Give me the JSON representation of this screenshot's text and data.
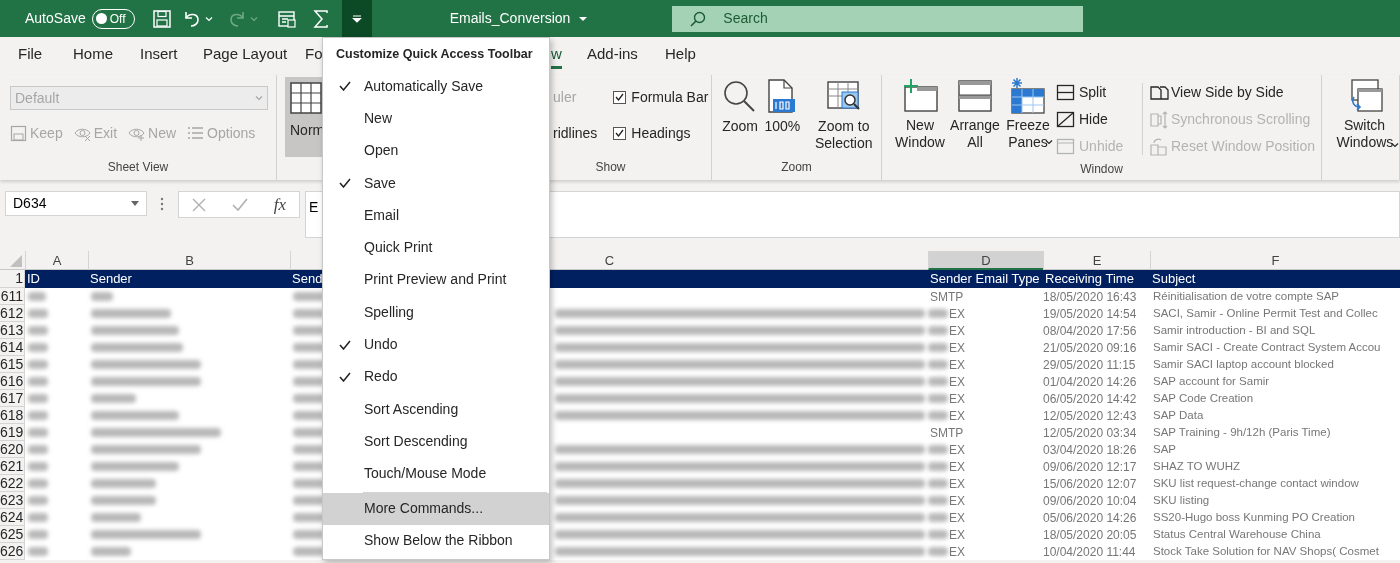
{
  "title_bar": {
    "autosave_label": "AutoSave",
    "autosave": {
      "on": false,
      "label": "Off"
    },
    "redo_disabled": true,
    "workbook_title": "Emails_Conversion",
    "search": {
      "placeholder": "Search"
    }
  },
  "tabs": [
    {
      "label": "File",
      "selected": false
    },
    {
      "label": "Home",
      "selected": false
    },
    {
      "label": "Insert",
      "selected": false
    },
    {
      "label": "Page Layout",
      "selected": false
    },
    {
      "label": "Fo",
      "selected": false
    },
    {
      "label": "w",
      "selected": true
    },
    {
      "label": "Add-ins",
      "selected": false
    },
    {
      "label": "Help",
      "selected": false
    }
  ],
  "ribbon": {
    "sheet_view": {
      "select": {
        "value": "Default",
        "disabled": true
      },
      "buttons": [
        {
          "label": "Keep",
          "disabled": true
        },
        {
          "label": "Exit",
          "disabled": true
        },
        {
          "label": "New",
          "disabled": true
        },
        {
          "label": "Options",
          "disabled": true
        }
      ],
      "label": "Sheet View"
    },
    "workbook_views": {
      "buttons": [
        {
          "label": "Norm",
          "selected": true
        }
      ]
    },
    "show": {
      "partial_items": [
        {
          "label": "uler",
          "disabled": true
        },
        {
          "label": "ridlines",
          "disabled": false
        }
      ],
      "checkboxes": [
        {
          "label": "Formula Bar",
          "checked": true
        },
        {
          "label": "Headings",
          "checked": true
        }
      ],
      "label": "Show"
    },
    "zoom": {
      "buttons": [
        {
          "label": "Zoom"
        },
        {
          "label": "100%"
        },
        {
          "label": "Zoom to Selection"
        }
      ],
      "label": "Zoom"
    },
    "window": {
      "large_buttons": [
        {
          "label": "New Window",
          "dropdown": false
        },
        {
          "label": "Arrange All",
          "dropdown": false
        },
        {
          "label": "Freeze Panes",
          "dropdown": true
        }
      ],
      "small_buttons": [
        {
          "label": "Split",
          "disabled": false
        },
        {
          "label": "Hide",
          "disabled": false
        },
        {
          "label": "Unhide",
          "disabled": true
        }
      ],
      "side_buttons": [
        {
          "label": "View Side by Side",
          "disabled": false
        },
        {
          "label": "Synchronous Scrolling",
          "disabled": true
        },
        {
          "label": "Reset Window Position",
          "disabled": true
        }
      ],
      "label": "Window"
    },
    "switch_windows": {
      "label": "Switch Windows",
      "dropdown": true
    }
  },
  "formula_bar": {
    "name_box": "D634",
    "fx": "fx",
    "value": "E"
  },
  "column_headers": [
    {
      "label": "A",
      "selected": false
    },
    {
      "label": "B",
      "selected": false
    },
    {
      "label": "C",
      "selected": false
    },
    {
      "label": "D",
      "selected": true
    },
    {
      "label": "E",
      "selected": false
    },
    {
      "label": "F",
      "selected": false
    }
  ],
  "header_row": {
    "row": "1",
    "cells": [
      "ID",
      "Sender",
      "Send",
      "Sender Email Type",
      "Receiving Time",
      "Subject"
    ]
  },
  "rows": [
    {
      "row": "611",
      "kind": "smtp",
      "sender_email_type": "SMTP",
      "receiving_time": "18/05/2020 16:43",
      "subject": "Réinitialisation de votre compte SAP"
    },
    {
      "row": "612",
      "kind": "exchange",
      "sender_email_type": "EX",
      "receiving_time": "19/05/2020 14:54",
      "subject": "SACI, Samir - Online Permit Test and Collec"
    },
    {
      "row": "613",
      "kind": "exchange",
      "sender_email_type": "EX",
      "receiving_time": "08/04/2020 17:56",
      "subject": "Samir introduction - BI and SQL"
    },
    {
      "row": "614",
      "kind": "exchange",
      "sender_email_type": "EX",
      "receiving_time": "21/05/2020 09:16",
      "subject": "Samir SACI - Create Contract System Accou"
    },
    {
      "row": "615",
      "kind": "exchange",
      "sender_email_type": "EX",
      "receiving_time": "29/05/2020 11:15",
      "subject": "Samir SACI laptop account blocked"
    },
    {
      "row": "616",
      "kind": "exchange",
      "sender_email_type": "EX",
      "receiving_time": "01/04/2020 14:26",
      "subject": "SAP account for Samir"
    },
    {
      "row": "617",
      "kind": "exchange",
      "sender_email_type": "EX",
      "receiving_time": "06/05/2020 14:42",
      "subject": "SAP Code Creation"
    },
    {
      "row": "618",
      "kind": "exchange",
      "sender_email_type": "EX",
      "receiving_time": "12/05/2020 12:43",
      "subject": "SAP Data"
    },
    {
      "row": "619",
      "kind": "smtp",
      "sender_email_type": "SMTP",
      "receiving_time": "12/05/2020 03:34",
      "subject": "SAP Training - 9h/12h (Paris Time)"
    },
    {
      "row": "620",
      "kind": "exchange",
      "sender_email_type": "EX",
      "receiving_time": "03/04/2020 18:26",
      "subject": "SAP"
    },
    {
      "row": "621",
      "kind": "exchange",
      "sender_email_type": "EX",
      "receiving_time": "09/06/2020 12:17",
      "subject": "SHAZ TO WUHZ"
    },
    {
      "row": "622",
      "kind": "exchange",
      "sender_email_type": "EX",
      "receiving_time": "15/06/2020 12:07",
      "subject": "SKU list request-change contact window"
    },
    {
      "row": "623",
      "kind": "exchange",
      "sender_email_type": "EX",
      "receiving_time": "09/06/2020 10:04",
      "subject": "SKU listing"
    },
    {
      "row": "624",
      "kind": "exchange",
      "sender_email_type": "EX",
      "receiving_time": "05/06/2020 14:26",
      "subject": "SS20-Hugo boss Kunming PO Creation"
    },
    {
      "row": "625",
      "kind": "exchange",
      "sender_email_type": "EX",
      "receiving_time": "18/05/2020 20:05",
      "subject": "Status Central Warehouse China"
    },
    {
      "row": "626",
      "kind": "exchange",
      "sender_email_type": "EX",
      "receiving_time": "10/04/2020 11:44",
      "subject": "Stock Take Solution for NAV Shops( Cosmet"
    }
  ],
  "qat_menu": {
    "title": "Customize Quick Access Toolbar",
    "toggles": [
      {
        "label": "Automatically Save",
        "checked": true
      },
      {
        "label": "New",
        "checked": false
      },
      {
        "label": "Open",
        "checked": false
      },
      {
        "label": "Save",
        "checked": true
      },
      {
        "label": "Email",
        "checked": false
      },
      {
        "label": "Quick Print",
        "checked": false
      },
      {
        "label": "Print Preview and Print",
        "checked": false
      },
      {
        "label": "Spelling",
        "checked": false
      },
      {
        "label": "Undo",
        "checked": true
      },
      {
        "label": "Redo",
        "checked": true
      },
      {
        "label": "Sort Ascending",
        "checked": false
      },
      {
        "label": "Sort Descending",
        "checked": false
      },
      {
        "label": "Touch/Mouse Mode",
        "checked": false
      }
    ],
    "commands": [
      {
        "label": "More Commands...",
        "highlighted": true
      },
      {
        "label": "Show Below the Ribbon",
        "highlighted": false
      }
    ]
  }
}
